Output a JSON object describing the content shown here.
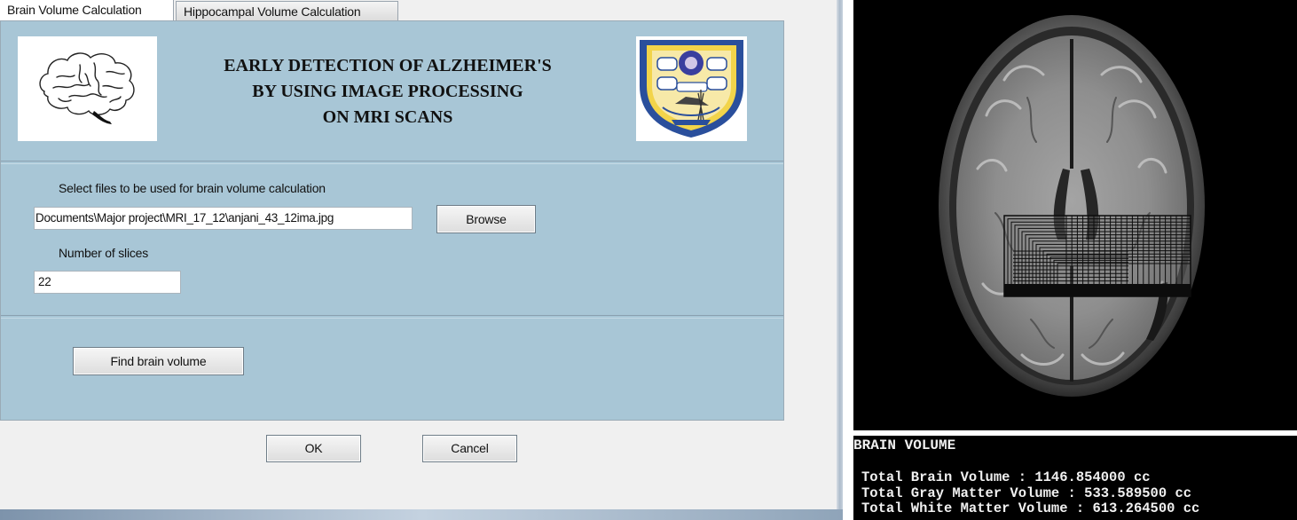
{
  "tabs": [
    {
      "label": "Brain Volume Calculation",
      "active": true
    },
    {
      "label": "Hippocampal Volume Calculation",
      "active": false
    }
  ],
  "header": {
    "title_lines": [
      "EARLY DETECTION OF ALZHEIMER'S",
      "BY USING IMAGE PROCESSING",
      "ON MRI SCANS"
    ],
    "left_logo_icon": "brain-outline-icon",
    "right_logo_icon": "institution-crest-icon"
  },
  "file_section": {
    "label": "Select files to be used for brain volume calculation",
    "path_value": "Documents\\Major project\\MRI_17_12\\anjani_43_12ima.jpg",
    "browse_label": "Browse"
  },
  "slices": {
    "label": "Number of slices",
    "value": "22"
  },
  "actions": {
    "find_label": "Find brain volume",
    "ok_label": "OK",
    "cancel_label": "Cancel"
  },
  "console": {
    "heading": "BRAIN VOLUME",
    "lines": [
      "Total Brain Volume : 1146.854000 cc",
      "Total Gray Matter Volume : 533.589500 cc",
      "Total White Matter Volume : 613.264500 cc"
    ]
  },
  "colors": {
    "panel_bg": "#a8c6d6",
    "dialog_bg": "#f0f0f0",
    "console_bg": "#000000",
    "console_text": "#f0f0f0",
    "crest_blue": "#2a4f9c",
    "crest_yellow": "#f2d44a"
  }
}
